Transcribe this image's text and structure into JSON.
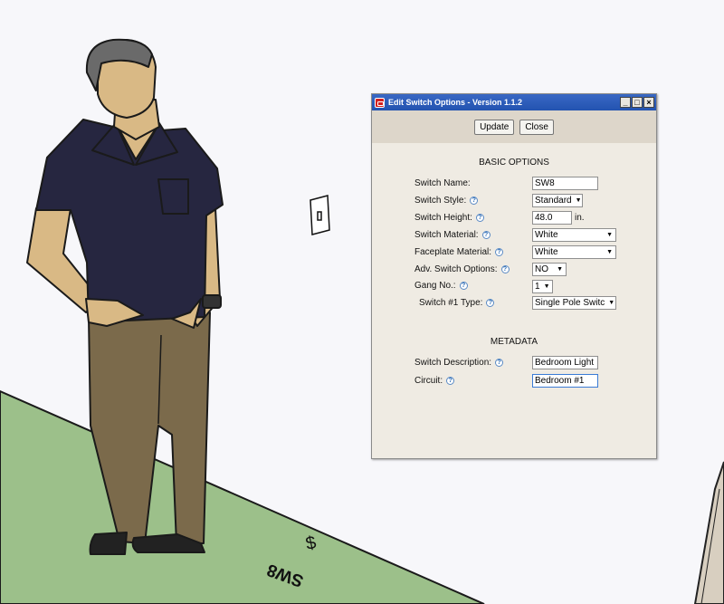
{
  "dialog": {
    "title": "Edit Switch Options - Version 1.1.2",
    "window_buttons": {
      "minimize": "_",
      "maximize": "□",
      "close": "×"
    },
    "buttons": {
      "update": "Update",
      "close": "Close"
    },
    "basic_heading": "BASIC OPTIONS",
    "fields": {
      "switch_name": {
        "label": "Switch Name:",
        "value": "SW8"
      },
      "switch_style": {
        "label": "Switch Style:",
        "value": "Standard"
      },
      "switch_height": {
        "label": "Switch Height:",
        "value": "48.0",
        "unit": "in."
      },
      "switch_material": {
        "label": "Switch Material:",
        "value": "White"
      },
      "faceplate_material": {
        "label": "Faceplate Material:",
        "value": "White"
      },
      "adv_switch_options": {
        "label": "Adv. Switch Options:",
        "value": "NO"
      },
      "gang_no": {
        "label": "Gang No.:",
        "value": "1"
      },
      "switch1_type": {
        "label": "Switch #1 Type:",
        "value": "Single Pole Switc"
      }
    },
    "metadata_heading": "METADATA",
    "metadata": {
      "switch_description": {
        "label": "Switch Description:",
        "value": "Bedroom Light"
      },
      "circuit": {
        "label": "Circuit:",
        "value": "Bedroom #1"
      }
    },
    "help_glyph": "?",
    "caret_glyph": "▼"
  },
  "scene": {
    "floor_label": "SW8",
    "floor_symbol": "$",
    "colors": {
      "floor": "#9cc08a",
      "shirt": "#262640",
      "pants": "#7b6a4b",
      "skin": "#d9b985",
      "hair": "#6a6a6a"
    }
  }
}
